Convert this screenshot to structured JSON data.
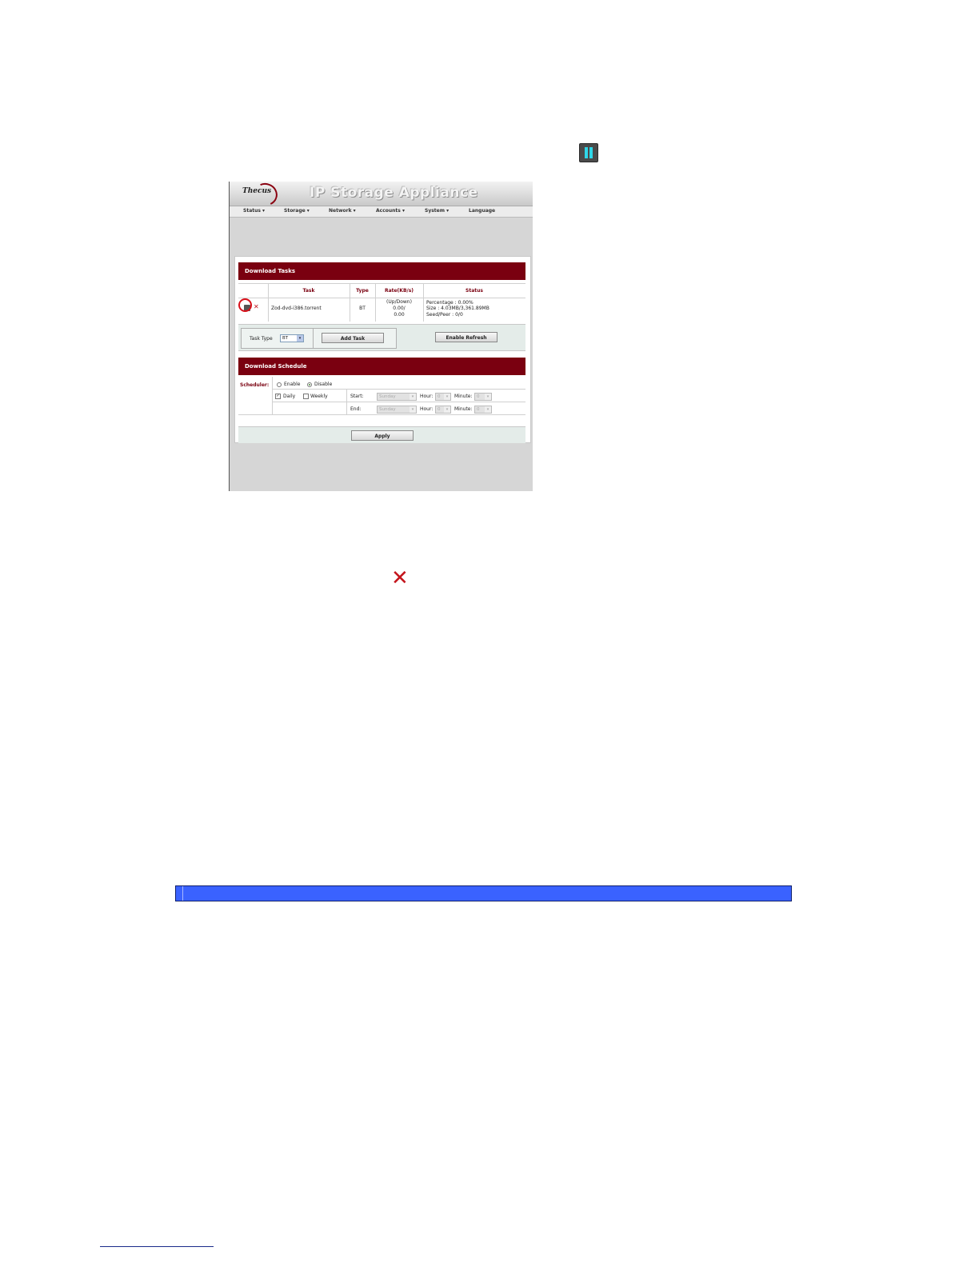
{
  "app": {
    "brand": "Thecus",
    "title": "IP Storage Appliance",
    "menu": [
      "Status",
      "Storage",
      "Network",
      "Accounts",
      "System",
      "Language"
    ]
  },
  "download_tasks": {
    "heading": "Download Tasks",
    "columns": [
      "Task",
      "Type",
      "Rate(KB/s)",
      "Status"
    ],
    "rows": [
      {
        "task": "Zod-dvd-i386.torrent",
        "type": "BT",
        "rate_line1": "(Up/Down)",
        "rate_line2": "0.00/",
        "rate_line3": "0.00",
        "status_line1": "Percentage : 0.00%",
        "status_line2": "Size : 4.03MB/3,361.89MB",
        "status_line3": "Seed/Peer : 0/0"
      }
    ],
    "task_type_label": "Task Type",
    "task_type_value": "BT",
    "add_task_label": "Add Task",
    "enable_refresh_label": "Enable Refresh"
  },
  "download_schedule": {
    "heading": "Download Schedule",
    "scheduler_label": "Scheduler:",
    "enable_label": "Enable",
    "disable_label": "Disable",
    "selected": "Disable",
    "daily_label": "Daily",
    "weekly_label": "Weekly",
    "start_label": "Start:",
    "end_label": "End:",
    "day_value": "Sunday",
    "hour_label": "Hour:",
    "minute_label": "Minute:",
    "hour_value": "0",
    "minute_value": "0",
    "apply_label": "Apply"
  },
  "icons": {
    "pause": "pause-icon",
    "delete": "delete-x-icon"
  },
  "colors": {
    "header_maroon": "#7a0010",
    "highlight_red": "#d8101a",
    "blue_bar": "#3a62ff",
    "pause_cyan": "#2fd7e8"
  }
}
